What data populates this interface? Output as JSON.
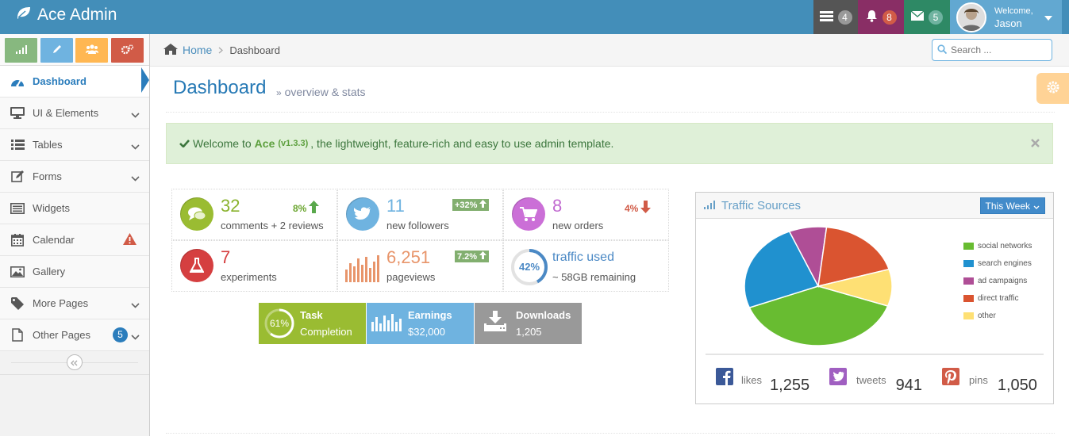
{
  "brand": {
    "name": "Ace Admin"
  },
  "topnav": {
    "tasks_count": "4",
    "notifications_count": "8",
    "messages_count": "5",
    "welcome": "Welcome,",
    "username": "Jason"
  },
  "sidebar": {
    "items": [
      {
        "label": "Dashboard"
      },
      {
        "label": "UI & Elements"
      },
      {
        "label": "Tables"
      },
      {
        "label": "Forms"
      },
      {
        "label": "Widgets"
      },
      {
        "label": "Calendar"
      },
      {
        "label": "Gallery"
      },
      {
        "label": "More Pages"
      },
      {
        "label": "Other Pages",
        "badge": "5"
      }
    ]
  },
  "breadcrumb": {
    "home": "Home",
    "current": "Dashboard"
  },
  "search": {
    "placeholder": "Search ..."
  },
  "page": {
    "title": "Dashboard",
    "subtitle": "overview & stats"
  },
  "alert": {
    "prefix": "Welcome to",
    "product": "Ace",
    "version": "(v1.3.3)",
    "suffix": ", the lightweight, feature-rich and easy to use admin template."
  },
  "infoboxes": [
    {
      "number": "32",
      "text": "comments + 2 reviews",
      "stat": "8%"
    },
    {
      "number": "11",
      "text": "new followers",
      "stat": "+32%"
    },
    {
      "number": "8",
      "text": "new orders",
      "stat": "4%"
    },
    {
      "number": "7",
      "text": "experiments"
    },
    {
      "number": "6,251",
      "text": "pageviews",
      "stat": "7.2%"
    },
    {
      "number": "traffic used",
      "text": "~ 58GB remaining",
      "percent": "42%"
    }
  ],
  "bigboxes": [
    {
      "percent": "61%",
      "title": "Task",
      "sub": "Completion"
    },
    {
      "title": "Earnings",
      "sub": "$32,000"
    },
    {
      "title": "Downloads",
      "sub": "1,205"
    }
  ],
  "traffic": {
    "title": "Traffic Sources",
    "range": "This Week",
    "colors": {
      "social networks": "#68bc31",
      "search engines": "#2091cf",
      "ad campaigns": "#af4e96",
      "direct traffic": "#da5430",
      "other": "#fee074"
    },
    "legend": [
      "social networks",
      "search engines",
      "ad campaigns",
      "direct traffic",
      "other"
    ],
    "social": [
      {
        "label": "likes",
        "value": "1,255"
      },
      {
        "label": "tweets",
        "value": "941"
      },
      {
        "label": "pins",
        "value": "1,050"
      }
    ]
  },
  "chart_data": {
    "type": "pie",
    "categories": [
      "social networks",
      "search engines",
      "ad campaigns",
      "direct traffic",
      "other"
    ],
    "values": [
      38.7,
      24.5,
      8.2,
      18.6,
      10
    ]
  }
}
